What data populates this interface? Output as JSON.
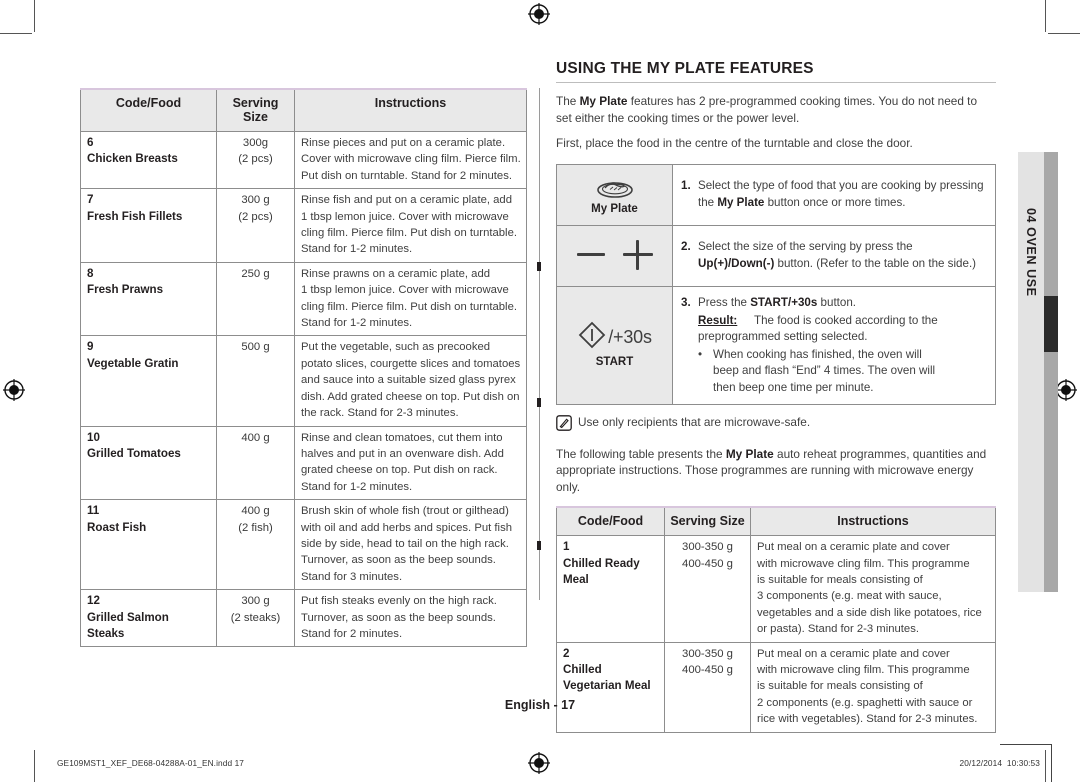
{
  "left_table": {
    "headers": [
      "Code/Food",
      "Serving Size",
      "Instructions"
    ],
    "rows": [
      {
        "code": "6",
        "food": "Chicken Breasts",
        "size": [
          "300g",
          "(2 pcs)"
        ],
        "instructions": [
          "Rinse pieces and put on a ceramic plate.",
          "Cover with microwave cling film. Pierce film.",
          "Put dish on turntable. Stand for 2 minutes."
        ]
      },
      {
        "code": "7",
        "food": "Fresh Fish Fillets",
        "size": [
          "300 g",
          "(2 pcs)"
        ],
        "instructions": [
          "Rinse fish and put on a ceramic plate, add",
          "1 tbsp lemon juice. Cover with microwave",
          "cling film. Pierce film. Put dish on turntable.",
          "Stand for 1-2 minutes."
        ]
      },
      {
        "code": "8",
        "food": "Fresh Prawns",
        "size": [
          "250 g"
        ],
        "instructions": [
          "Rinse prawns on a ceramic plate, add",
          "1 tbsp lemon juice. Cover with microwave",
          "cling film. Pierce film. Put dish on turntable.",
          "Stand for 1-2 minutes."
        ]
      },
      {
        "code": "9",
        "food": "Vegetable Gratin",
        "size": [
          "500 g"
        ],
        "instructions": [
          "Put the vegetable, such as precooked",
          "potato slices, courgette slices and tomatoes",
          "and sauce into a suitable sized glass pyrex",
          "dish. Add grated cheese on top. Put dish on",
          "the rack. Stand for 2-3 minutes."
        ]
      },
      {
        "code": "10",
        "food": "Grilled Tomatoes",
        "size": [
          "400 g"
        ],
        "instructions": [
          "Rinse and clean tomatoes, cut them into",
          "halves and put in an ovenware dish. Add",
          "grated cheese on top. Put dish on rack.",
          "Stand for 1-2 minutes."
        ]
      },
      {
        "code": "11",
        "food": "Roast Fish",
        "size": [
          "400 g",
          "(2 fish)"
        ],
        "instructions": [
          "Brush skin of whole fish (trout or gilthead)",
          "with oil and add herbs and spices. Put fish",
          "side by side, head to tail on the high rack.",
          "Turnover, as soon as the beep sounds.",
          "Stand for 3 minutes."
        ]
      },
      {
        "code": "12",
        "food": "Grilled Salmon Steaks",
        "food_lines": [
          "Grilled Salmon",
          "Steaks"
        ],
        "size": [
          "300 g",
          "(2 steaks)"
        ],
        "instructions": [
          "Put fish steaks evenly on the high rack.",
          "Turnover, as soon as the beep sounds.",
          "Stand for 2 minutes."
        ]
      }
    ]
  },
  "section": {
    "title": "Using the My Plate Features",
    "intro_1_pre": "The ",
    "intro_1_bold": "My Plate",
    "intro_1_post": " features has 2 pre-programmed cooking times. You do not need to set either the cooking times or the power level.",
    "intro_2": "First, place the food in the centre of the turntable and close the door."
  },
  "steps": [
    {
      "num": "1.",
      "button_icon": "my-plate-icon",
      "button_label": "My Plate",
      "text_pre": "Select the type of food that you are cooking by pressing the ",
      "text_bold": "My Plate",
      "text_post": " button once or more times."
    },
    {
      "num": "2.",
      "button_icon": "minus-plus-icon",
      "button_label": "",
      "text_pre": "Select the size of the serving by press the ",
      "text_bold": "Up(+)/Down(-)",
      "text_post": " button. (Refer to the table on the side.)"
    },
    {
      "num": "3.",
      "button_icon": "start-icon",
      "button_glyph": "/+30s",
      "button_label": "START",
      "text_pre": "Press the ",
      "text_bold": "START/+30s",
      "text_post": " button.",
      "result_label": "Result:",
      "result_lines": [
        "The food is cooked according to the",
        "preprogrammed setting selected."
      ],
      "bullet_lines": [
        "When cooking has finished, the oven will",
        "beep and flash “End” 4 times. The oven will",
        "then beep one time per minute."
      ]
    }
  ],
  "note": {
    "icon": "note-pen-icon",
    "text": "Use only recipients that are microwave-safe."
  },
  "table_intro": {
    "pre": "The following table presents the ",
    "bold": "My Plate",
    "post": " auto reheat programmes, quantities and appropriate instructions. Those programmes are running with microwave energy only."
  },
  "right_table": {
    "headers": [
      "Code/Food",
      "Serving Size",
      "Instructions"
    ],
    "rows": [
      {
        "code": "1",
        "food_lines": [
          "Chilled Ready",
          "Meal"
        ],
        "size": [
          "300-350 g",
          "400-450 g"
        ],
        "instructions": [
          "Put meal on a ceramic plate and cover",
          "with microwave cling film. This programme",
          "is suitable for meals consisting of",
          "3 components (e.g. meat with sauce,",
          "vegetables and a side dish like potatoes, rice",
          "or pasta). Stand for 2-3 minutes."
        ]
      },
      {
        "code": "2",
        "food_lines": [
          "Chilled",
          "Vegetarian Meal"
        ],
        "size": [
          "300-350 g",
          "400-450 g"
        ],
        "instructions": [
          "Put meal on a ceramic plate and cover",
          "with microwave cling film. This programme",
          "is suitable for meals consisting of",
          "2 components (e.g. spaghetti with sauce or",
          "rice with vegetables). Stand for 2-3 minutes."
        ]
      }
    ]
  },
  "side_tab": {
    "label": "04  OVEN USE"
  },
  "footer": {
    "page_label": "English - 17",
    "file_name": "GE109MST1_XEF_DE68-04288A-01_EN.indd   17",
    "date": "20/12/2014",
    "time": "10:30:53"
  },
  "colors": {
    "header_fill": "#e9e9e9",
    "header_top_rule": "#d8c6dd",
    "border": "#8d8d8d",
    "text": "#231f20",
    "body_text": "#3f3f3f",
    "tab_light": "#e3e3e3",
    "tab_mid": "#a8a8a8",
    "tab_dark": "#2b2b2b"
  }
}
